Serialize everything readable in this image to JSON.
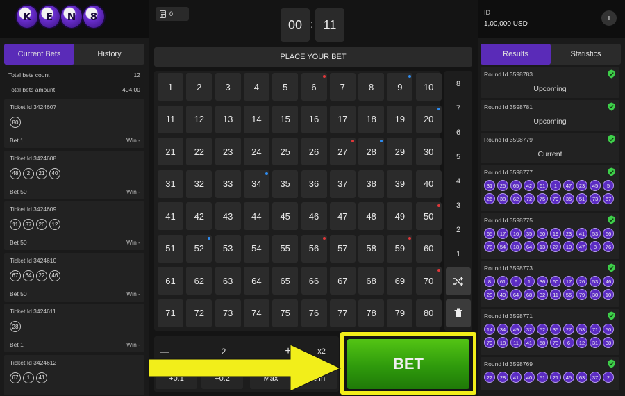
{
  "logo": {
    "letters": [
      "K",
      "E",
      "N",
      "8"
    ]
  },
  "left": {
    "tabs": [
      {
        "label": "Current Bets",
        "active": true
      },
      {
        "label": "History",
        "active": false
      }
    ],
    "stats": [
      {
        "label": "Total bets count",
        "value": "12"
      },
      {
        "label": "Total bets amount",
        "value": "404.00"
      }
    ],
    "tickets": [
      {
        "id": "Ticket Id 3424607",
        "numbers": [
          "80"
        ],
        "bet": "Bet 1",
        "win": "Win -"
      },
      {
        "id": "Ticket Id 3424608",
        "numbers": [
          "48",
          "2",
          "21",
          "40"
        ],
        "bet": "Bet 50",
        "win": "Win -"
      },
      {
        "id": "Ticket Id 3424609",
        "numbers": [
          "11",
          "37",
          "26",
          "12"
        ],
        "bet": "Bet 50",
        "win": "Win -"
      },
      {
        "id": "Ticket Id 3424610",
        "numbers": [
          "67",
          "64",
          "22",
          "46"
        ],
        "bet": "Bet 50",
        "win": "Win -"
      },
      {
        "id": "Ticket Id 3424611",
        "numbers": [
          "28"
        ],
        "bet": "Bet 1",
        "win": "Win -"
      },
      {
        "id": "Ticket Id 3424612",
        "numbers": [
          "67",
          "1",
          "41"
        ],
        "bet": "",
        "win": ""
      }
    ]
  },
  "center": {
    "balance": "0",
    "timer": {
      "minutes": "00",
      "seconds": "11",
      "sep": ":"
    },
    "place_bet_label": "PLACE YOUR BET",
    "red_dot_numbers": [
      6,
      27,
      50,
      56,
      59,
      70
    ],
    "blue_dot_numbers": [
      9,
      20,
      28,
      34,
      52
    ],
    "dot_colors": {
      "red": "#e0383a",
      "blue": "#2f8cf0"
    },
    "hit_labels": [
      "8",
      "7",
      "6",
      "5",
      "4",
      "3",
      "2",
      "1"
    ],
    "controls": {
      "minus": "—",
      "amount": "2",
      "plus": "+",
      "x2": "x2",
      "quick": [
        "+0.1",
        "+0.2",
        "Max",
        "All In"
      ]
    },
    "bet_label": "BET",
    "colors": {
      "accent": "#5a2bb8",
      "highlight": "#f2ee1a",
      "bet_green": "#3fae10"
    }
  },
  "right": {
    "account": {
      "label": "ID",
      "balance": "1,00,000 USD",
      "info": "i"
    },
    "tabs": [
      {
        "label": "Results",
        "active": true
      },
      {
        "label": "Statistics",
        "active": false
      }
    ],
    "rounds": [
      {
        "id": "Round Id 3598783",
        "state": "Upcoming"
      },
      {
        "id": "Round Id 3598781",
        "state": "Upcoming"
      },
      {
        "id": "Round Id 3598779",
        "state": "Current"
      },
      {
        "id": "Round Id 3598777",
        "numbers": [
          "31",
          "25",
          "65",
          "42",
          "61",
          "1",
          "47",
          "23",
          "45",
          "5",
          "26",
          "38",
          "62",
          "72",
          "75",
          "79",
          "35",
          "51",
          "73",
          "67"
        ]
      },
      {
        "id": "Round Id 3598775",
        "numbers": [
          "65",
          "17",
          "16",
          "35",
          "50",
          "19",
          "23",
          "41",
          "53",
          "66",
          "78",
          "54",
          "18",
          "64",
          "13",
          "27",
          "10",
          "47",
          "8",
          "76"
        ]
      },
      {
        "id": "Round Id 3598773",
        "numbers": [
          "8",
          "61",
          "6",
          "1",
          "36",
          "60",
          "17",
          "26",
          "53",
          "46",
          "20",
          "40",
          "64",
          "68",
          "32",
          "11",
          "56",
          "79",
          "30",
          "10"
        ]
      },
      {
        "id": "Round Id 3598771",
        "numbers": [
          "14",
          "34",
          "49",
          "32",
          "52",
          "35",
          "27",
          "53",
          "71",
          "50",
          "79",
          "18",
          "11",
          "41",
          "58",
          "73",
          "6",
          "12",
          "31",
          "38"
        ]
      },
      {
        "id": "Round Id 3598769",
        "numbers": [
          "22",
          "28",
          "41",
          "40",
          "51",
          "21",
          "45",
          "63",
          "37",
          "2"
        ]
      }
    ]
  }
}
